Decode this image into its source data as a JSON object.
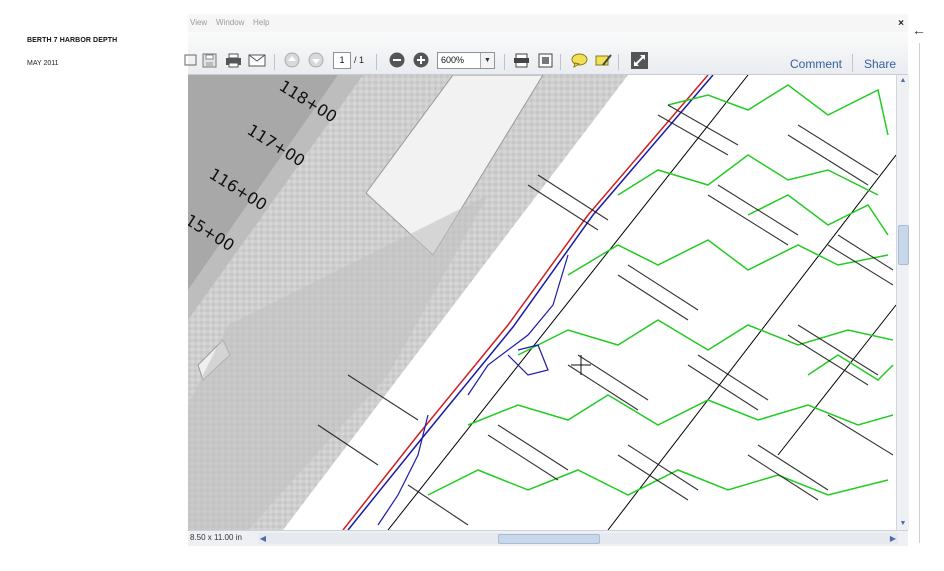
{
  "caption": {
    "title": "BERTH 7 HARBOR DEPTH",
    "date": "MAY 2011"
  },
  "menu": {
    "items": [
      "View",
      "Window",
      "Help"
    ],
    "close_glyph": "×"
  },
  "toolbar": {
    "page_current": "1",
    "page_total": "/ 1",
    "zoom": "600%",
    "comment_label": "Comment",
    "share_label": "Share"
  },
  "status": {
    "page_size": "8.50 x 11.00 in"
  },
  "map": {
    "station_labels": [
      "118+00",
      "117+00",
      "116+00",
      "15+00"
    ],
    "colors": {
      "contour": "#22cc22",
      "blue_line": "#1a1aa8",
      "red_line": "#d02020",
      "black_line": "#000000"
    }
  }
}
